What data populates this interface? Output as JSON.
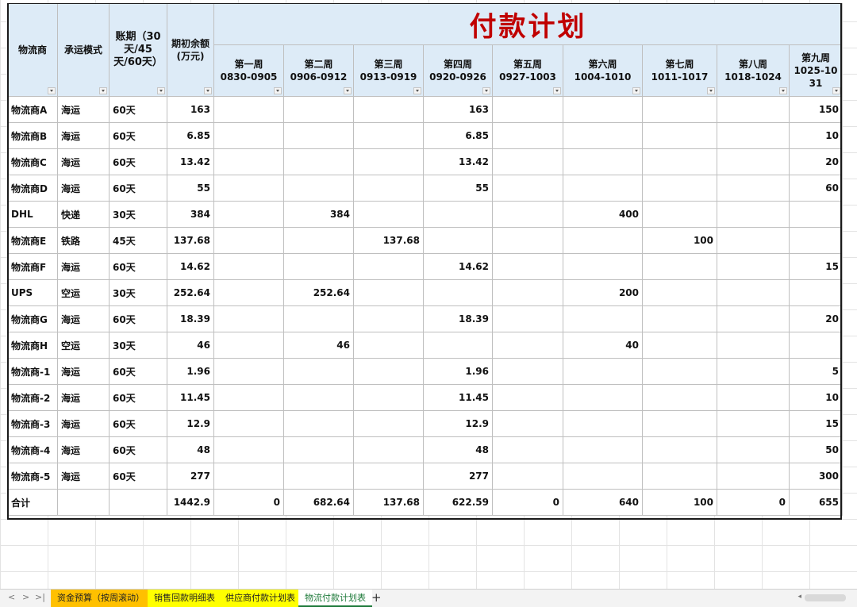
{
  "table": {
    "title": "付款计划",
    "headers": {
      "logistics": "物流商",
      "mode": "承运模式",
      "term": "账期（30天/45天/60天）",
      "balance": "期初余额(万元)"
    },
    "weeks": [
      {
        "name": "第一周",
        "range": "0830-0905"
      },
      {
        "name": "第二周",
        "range": "0906-0912"
      },
      {
        "name": "第三周",
        "range": "0913-0919"
      },
      {
        "name": "第四周",
        "range": "0920-0926"
      },
      {
        "name": "第五周",
        "range": "0927-1003"
      },
      {
        "name": "第六周",
        "range": "1004-1010"
      },
      {
        "name": "第七周",
        "range": "1011-1017"
      },
      {
        "name": "第八周",
        "range": "1018-1024"
      },
      {
        "name": "第九周",
        "range": "1025-1031"
      }
    ],
    "rows": [
      {
        "name": "物流商A",
        "mode": "海运",
        "term": "60天",
        "balance": "163",
        "w": [
          "",
          "",
          "",
          "163",
          "",
          "",
          "",
          "",
          "150"
        ]
      },
      {
        "name": "物流商B",
        "mode": "海运",
        "term": "60天",
        "balance": "6.85",
        "w": [
          "",
          "",
          "",
          "6.85",
          "",
          "",
          "",
          "",
          "10"
        ]
      },
      {
        "name": "物流商C",
        "mode": "海运",
        "term": "60天",
        "balance": "13.42",
        "w": [
          "",
          "",
          "",
          "13.42",
          "",
          "",
          "",
          "",
          "20"
        ]
      },
      {
        "name": "物流商D",
        "mode": "海运",
        "term": "60天",
        "balance": "55",
        "w": [
          "",
          "",
          "",
          "55",
          "",
          "",
          "",
          "",
          "60"
        ]
      },
      {
        "name": "DHL",
        "mode": "快递",
        "term": "30天",
        "balance": "384",
        "w": [
          "",
          "384",
          "",
          "",
          "",
          "400",
          "",
          "",
          ""
        ]
      },
      {
        "name": "物流商E",
        "mode": "铁路",
        "term": "45天",
        "balance": "137.68",
        "w": [
          "",
          "",
          "137.68",
          "",
          "",
          "",
          "100",
          "",
          ""
        ]
      },
      {
        "name": "物流商F",
        "mode": "海运",
        "term": "60天",
        "balance": "14.62",
        "w": [
          "",
          "",
          "",
          "14.62",
          "",
          "",
          "",
          "",
          "15"
        ]
      },
      {
        "name": "UPS",
        "mode": "空运",
        "term": "30天",
        "balance": "252.64",
        "w": [
          "",
          "252.64",
          "",
          "",
          "",
          "200",
          "",
          "",
          ""
        ]
      },
      {
        "name": "物流商G",
        "mode": "海运",
        "term": "60天",
        "balance": "18.39",
        "w": [
          "",
          "",
          "",
          "18.39",
          "",
          "",
          "",
          "",
          "20"
        ]
      },
      {
        "name": "物流商H",
        "mode": "空运",
        "term": "30天",
        "balance": "46",
        "w": [
          "",
          "46",
          "",
          "",
          "",
          "40",
          "",
          "",
          ""
        ]
      },
      {
        "name": "物流商-1",
        "mode": "海运",
        "term": "60天",
        "balance": "1.96",
        "w": [
          "",
          "",
          "",
          "1.96",
          "",
          "",
          "",
          "",
          "5"
        ]
      },
      {
        "name": "物流商-2",
        "mode": "海运",
        "term": "60天",
        "balance": "11.45",
        "w": [
          "",
          "",
          "",
          "11.45",
          "",
          "",
          "",
          "",
          "10"
        ]
      },
      {
        "name": "物流商-3",
        "mode": "海运",
        "term": "60天",
        "balance": "12.9",
        "w": [
          "",
          "",
          "",
          "12.9",
          "",
          "",
          "",
          "",
          "15"
        ]
      },
      {
        "name": "物流商-4",
        "mode": "海运",
        "term": "60天",
        "balance": "48",
        "w": [
          "",
          "",
          "",
          "48",
          "",
          "",
          "",
          "",
          "50"
        ]
      },
      {
        "name": "物流商-5",
        "mode": "海运",
        "term": "60天",
        "balance": "277",
        "w": [
          "",
          "",
          "",
          "277",
          "",
          "",
          "",
          "",
          "300"
        ]
      },
      {
        "name": "合计",
        "mode": "",
        "term": "",
        "balance": "1442.9",
        "w": [
          "0",
          "682.64",
          "137.68",
          "622.59",
          "0",
          "640",
          "100",
          "0",
          "655"
        ]
      }
    ]
  },
  "tabs": {
    "nav": [
      "<",
      ">",
      ">|"
    ],
    "sheets": [
      {
        "label": "资金预算（按周滚动）",
        "color": "orange"
      },
      {
        "label": "销售回款明细表",
        "color": "yellow"
      },
      {
        "label": "供应商付款计划表",
        "color": "yellow"
      },
      {
        "label": "物流付款计划表",
        "color": "active"
      }
    ],
    "add": "+"
  },
  "colors": {
    "title": "#c00000",
    "header_bg": "#ddebf7",
    "active_tab": "#1e7a3a"
  }
}
